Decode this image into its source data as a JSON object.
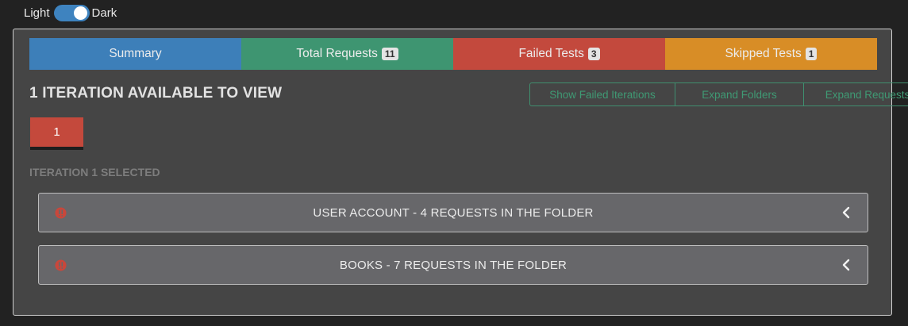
{
  "theme": {
    "light_label": "Light",
    "dark_label": "Dark",
    "dark_enabled": true
  },
  "tabs": [
    {
      "label": "Summary",
      "badge": null,
      "color": "#3d7fb9"
    },
    {
      "label": "Total Requests",
      "badge": "11",
      "color": "#3e9571"
    },
    {
      "label": "Failed Tests",
      "badge": "3",
      "color": "#c3493d"
    },
    {
      "label": "Skipped Tests",
      "badge": "1",
      "color": "#d88d26"
    }
  ],
  "iterations": {
    "heading": "1 ITERATION AVAILABLE TO VIEW",
    "buttons": {
      "show_failed": "Show Failed Iterations",
      "expand_folders": "Expand Folders",
      "expand_requests": "Expand Requests"
    },
    "items": [
      "1"
    ],
    "selected_label": "ITERATION 1 SELECTED"
  },
  "folders": [
    {
      "title": "USER ACCOUNT - 4 REQUESTS IN THE FOLDER",
      "status_icon": "error-icon",
      "toggle_icon": "chevron-left-icon"
    },
    {
      "title": "BOOKS - 7 REQUESTS IN THE FOLDER",
      "status_icon": "error-icon",
      "toggle_icon": "chevron-left-icon"
    }
  ],
  "colors": {
    "accent_green": "#3f9a74",
    "iteration_active": "#c4493c",
    "error_red": "#c9473b"
  }
}
